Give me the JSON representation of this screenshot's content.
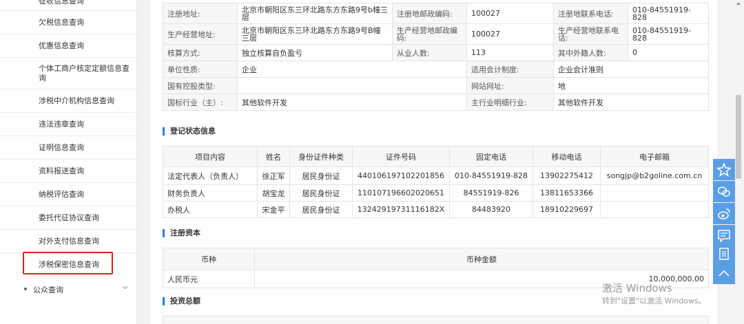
{
  "sidebar": {
    "items": [
      {
        "label": "征收信息查询"
      },
      {
        "label": "欠税信息查询"
      },
      {
        "label": "优惠信息查询"
      },
      {
        "label": "个体工商户核定定额信息查询"
      },
      {
        "label": "涉税中介机构信息查询"
      },
      {
        "label": "违法违章查询"
      },
      {
        "label": "证明信息查询"
      },
      {
        "label": "资料报送查询"
      },
      {
        "label": "纳税评估查询"
      },
      {
        "label": "委托代征协议查询"
      },
      {
        "label": "对外支付信息查询"
      },
      {
        "label": "涉税保密信息查询"
      }
    ],
    "public_query": "公众查询",
    "highlight_color": "#e02020"
  },
  "info": {
    "rows": [
      [
        "注册地址:",
        "北京市朝阳区东三环北路东方东路9号b幢三层",
        "注册地邮政编码:",
        "100027",
        "注册地联系电话:",
        "010-84551919-828"
      ],
      [
        "生产经营地址:",
        "北京市朝阳区东三环北路东方东路9号B幢三层",
        "生产经营地邮政编码:",
        "100027",
        "生产经营地联系电话:",
        "010-84551919-828"
      ],
      [
        "核算方式:",
        "独立核算自负盈亏",
        "从业人数:",
        "113",
        "其中外籍人数:",
        "0"
      ],
      [
        "单位性质:",
        "企业",
        "",
        "适用会计制度:",
        "企业会计准则"
      ],
      [
        "国有控股类型:",
        "",
        "",
        "网站网址:",
        "地"
      ],
      [
        "国标行业（主）:",
        "其他软件开发",
        "",
        "主行业明细行业:",
        "其他软件开发"
      ]
    ]
  },
  "registration": {
    "title": "登记状态信息",
    "headers": [
      "项目内容",
      "姓名",
      "身份证件种类",
      "证件号码",
      "固定电话",
      "移动电话",
      "电子邮箱"
    ],
    "rows": [
      [
        "法定代表人（负责人）",
        "徐正军",
        "居民身份证",
        "440106197102201856",
        "010-84551919-828",
        "13902275412",
        "songjp@b2goline.com.cn"
      ],
      [
        "财务负责人",
        "胡宝龙",
        "居民身份证",
        "110107196602020651",
        "84551919-826",
        "13811653366",
        ""
      ],
      [
        "办税人",
        "宋金平",
        "居民身份证",
        "13242919731116182X",
        "84483920",
        "18910229697",
        ""
      ]
    ]
  },
  "capital": {
    "title": "注册资本",
    "headers": [
      "币种",
      "币种金额"
    ],
    "rows": [
      [
        "人民币元",
        "10,000,000.00"
      ]
    ]
  },
  "investment": {
    "title": "投资总额"
  },
  "watermark": {
    "line1": "激活 Windows",
    "line2": "转到\"设置\"以激活 Windows。"
  },
  "colors": {
    "accent": "#2d7ed6",
    "float_button": "#5a9ee6"
  }
}
